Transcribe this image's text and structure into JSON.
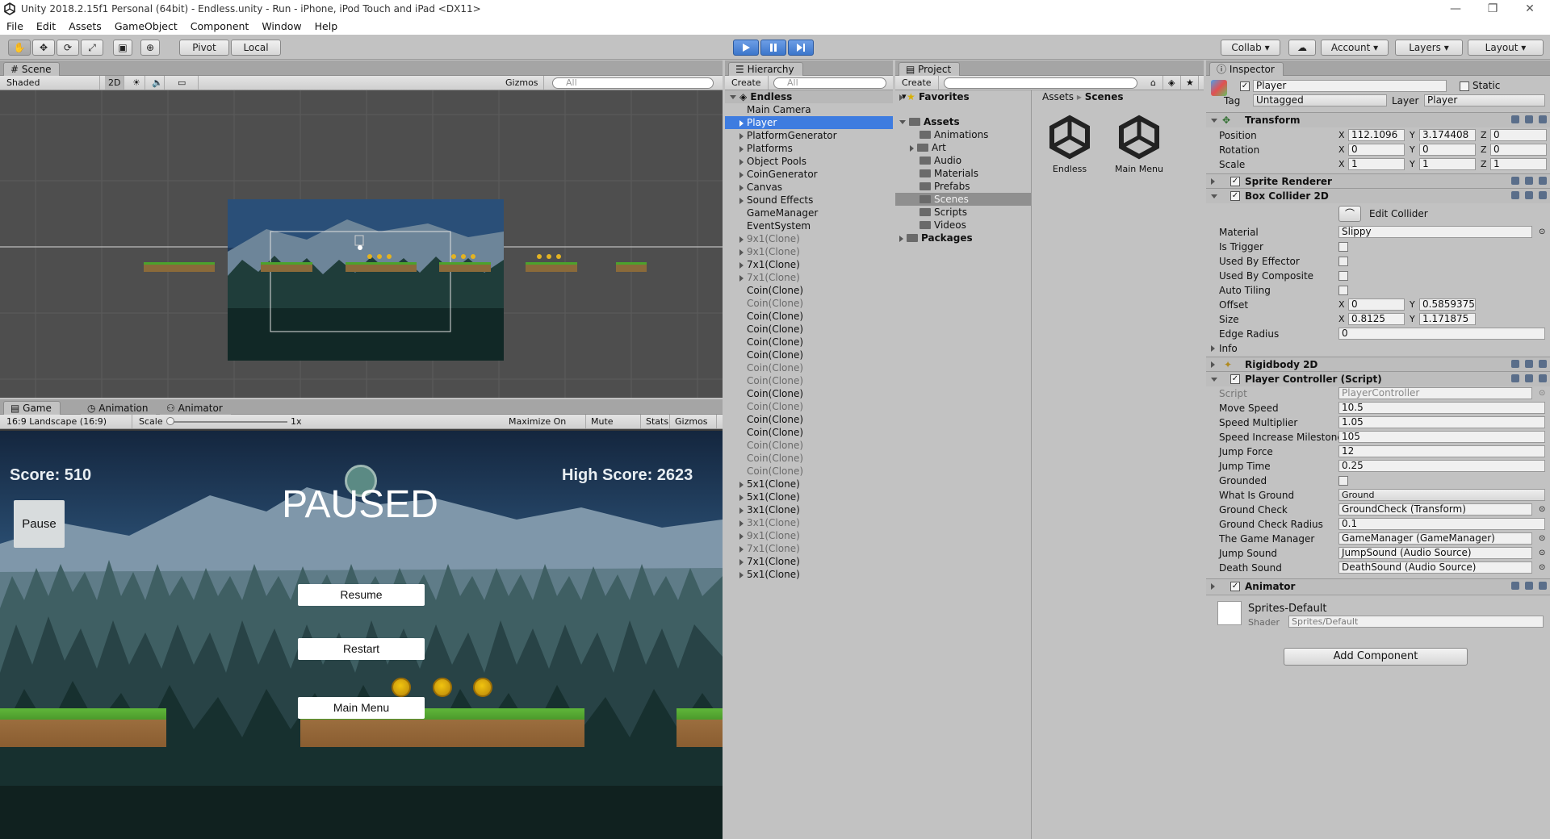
{
  "window": {
    "title": "Unity 2018.2.15f1 Personal (64bit) - Endless.unity - Run - iPhone, iPod Touch and iPad <DX11>"
  },
  "menu": [
    "File",
    "Edit",
    "Assets",
    "GameObject",
    "Component",
    "Window",
    "Help"
  ],
  "toolbar": {
    "pivot": "Pivot",
    "local": "Local",
    "collab": "Collab",
    "account": "Account",
    "layers": "Layers",
    "layout": "Layout"
  },
  "scene": {
    "tab": "Scene",
    "shading": "Shaded",
    "mode2d": "2D",
    "gizmos": "Gizmos",
    "search": "All"
  },
  "game": {
    "tabs": [
      "Game",
      "Animation",
      "Animator"
    ],
    "aspect": "16:9 Landscape (16:9)",
    "scale_label": "Scale",
    "scale_value": "1x",
    "options": [
      "Maximize On Play",
      "Mute Audio",
      "Stats",
      "Gizmos"
    ],
    "score": "Score: 510",
    "high_score": "High Score: 2623",
    "pause": "Pause",
    "paused": "PAUSED",
    "resume": "Resume",
    "restart": "Restart",
    "main_menu": "Main Menu"
  },
  "hierarchy": {
    "tab": "Hierarchy",
    "create": "Create",
    "search": "All",
    "scene": "Endless",
    "items": [
      {
        "label": "Main Camera",
        "arrow": false,
        "dim": false
      },
      {
        "label": "Player",
        "arrow": true,
        "dim": false
      },
      {
        "label": "PlatformGenerator",
        "arrow": true,
        "dim": false
      },
      {
        "label": "Platforms",
        "arrow": true,
        "dim": false
      },
      {
        "label": "Object Pools",
        "arrow": true,
        "dim": false
      },
      {
        "label": "CoinGenerator",
        "arrow": true,
        "dim": false
      },
      {
        "label": "Canvas",
        "arrow": true,
        "dim": false
      },
      {
        "label": "Sound Effects",
        "arrow": true,
        "dim": false
      },
      {
        "label": "GameManager",
        "arrow": false,
        "dim": false
      },
      {
        "label": "EventSystem",
        "arrow": false,
        "dim": false
      },
      {
        "label": "9x1(Clone)",
        "arrow": true,
        "dim": true
      },
      {
        "label": "9x1(Clone)",
        "arrow": true,
        "dim": true
      },
      {
        "label": "7x1(Clone)",
        "arrow": true,
        "dim": false
      },
      {
        "label": "7x1(Clone)",
        "arrow": true,
        "dim": true
      },
      {
        "label": "Coin(Clone)",
        "arrow": false,
        "dim": false
      },
      {
        "label": "Coin(Clone)",
        "arrow": false,
        "dim": true
      },
      {
        "label": "Coin(Clone)",
        "arrow": false,
        "dim": false
      },
      {
        "label": "Coin(Clone)",
        "arrow": false,
        "dim": false
      },
      {
        "label": "Coin(Clone)",
        "arrow": false,
        "dim": false
      },
      {
        "label": "Coin(Clone)",
        "arrow": false,
        "dim": false
      },
      {
        "label": "Coin(Clone)",
        "arrow": false,
        "dim": true
      },
      {
        "label": "Coin(Clone)",
        "arrow": false,
        "dim": true
      },
      {
        "label": "Coin(Clone)",
        "arrow": false,
        "dim": false
      },
      {
        "label": "Coin(Clone)",
        "arrow": false,
        "dim": true
      },
      {
        "label": "Coin(Clone)",
        "arrow": false,
        "dim": false
      },
      {
        "label": "Coin(Clone)",
        "arrow": false,
        "dim": false
      },
      {
        "label": "Coin(Clone)",
        "arrow": false,
        "dim": true
      },
      {
        "label": "Coin(Clone)",
        "arrow": false,
        "dim": true
      },
      {
        "label": "Coin(Clone)",
        "arrow": false,
        "dim": true
      },
      {
        "label": "5x1(Clone)",
        "arrow": true,
        "dim": false
      },
      {
        "label": "5x1(Clone)",
        "arrow": true,
        "dim": false
      },
      {
        "label": "3x1(Clone)",
        "arrow": true,
        "dim": false
      },
      {
        "label": "3x1(Clone)",
        "arrow": true,
        "dim": true
      },
      {
        "label": "9x1(Clone)",
        "arrow": true,
        "dim": true
      },
      {
        "label": "7x1(Clone)",
        "arrow": true,
        "dim": true
      },
      {
        "label": "7x1(Clone)",
        "arrow": true,
        "dim": false
      },
      {
        "label": "5x1(Clone)",
        "arrow": true,
        "dim": false
      }
    ]
  },
  "project": {
    "tab": "Project",
    "create": "Create",
    "favorites": "Favorites",
    "assets": "Assets",
    "folders": [
      "Animations",
      "Art",
      "Audio",
      "Materials",
      "Prefabs",
      "Scenes",
      "Scripts",
      "Videos"
    ],
    "packages": "Packages",
    "breadcrumb_root": "Assets",
    "breadcrumb_sep": "▸",
    "breadcrumb_current": "Scenes",
    "files": [
      "Endless",
      "Main Menu"
    ]
  },
  "inspector": {
    "tab": "Inspector",
    "name": "Player",
    "static": "Static",
    "tag_label": "Tag",
    "tag": "Untagged",
    "layer_label": "Layer",
    "layer": "Player",
    "transform": {
      "title": "Transform",
      "position_label": "Position",
      "rotation_label": "Rotation",
      "scale_label": "Scale",
      "position": [
        "112.1096",
        "3.174408",
        "0"
      ],
      "rotation": [
        "0",
        "0",
        "0"
      ],
      "scale": [
        "1",
        "1",
        "1"
      ]
    },
    "sprite_renderer": "Sprite Renderer",
    "box_collider": {
      "title": "Box Collider 2D",
      "edit": "Edit Collider",
      "material_label": "Material",
      "material": "Slippy",
      "is_trigger": "Is Trigger",
      "used_by_effector": "Used By Effector",
      "used_by_composite": "Used By Composite",
      "auto_tiling": "Auto Tiling",
      "offset_label": "Offset",
      "offset": [
        "0",
        "0.5859375"
      ],
      "size_label": "Size",
      "size": [
        "0.8125",
        "1.171875"
      ],
      "edge_radius_label": "Edge Radius",
      "edge_radius": "0",
      "info": "Info"
    },
    "rigidbody": "Rigidbody 2D",
    "player_controller": {
      "title": "Player Controller (Script)",
      "script_label": "Script",
      "script": "PlayerController",
      "move_speed_label": "Move Speed",
      "move_speed": "10.5",
      "speed_multiplier_label": "Speed Multiplier",
      "speed_multiplier": "1.05",
      "speed_increase_label": "Speed Increase Milestone",
      "speed_increase": "105",
      "jump_force_label": "Jump Force",
      "jump_force": "12",
      "jump_time_label": "Jump Time",
      "jump_time": "0.25",
      "grounded_label": "Grounded",
      "what_is_ground_label": "What Is Ground",
      "what_is_ground": "Ground",
      "ground_check_label": "Ground Check",
      "ground_check": "GroundCheck (Transform)",
      "ground_check_radius_label": "Ground Check Radius",
      "ground_check_radius": "0.1",
      "game_manager_label": "The Game Manager",
      "game_manager": "GameManager (GameManager)",
      "jump_sound_label": "Jump Sound",
      "jump_sound": "JumpSound (Audio Source)",
      "death_sound_label": "Death Sound",
      "death_sound": "DeathSound (Audio Source)"
    },
    "animator": "Animator",
    "material": {
      "name": "Sprites-Default",
      "shader_label": "Shader",
      "shader": "Sprites/Default"
    },
    "add_component": "Add Component",
    "xyz": [
      "X",
      "Y",
      "Z"
    ]
  },
  "colors": {
    "selection": "#3e7ce0",
    "play": "#3c76cb",
    "sky_top": "#1b3455",
    "forest": "#12272a"
  }
}
